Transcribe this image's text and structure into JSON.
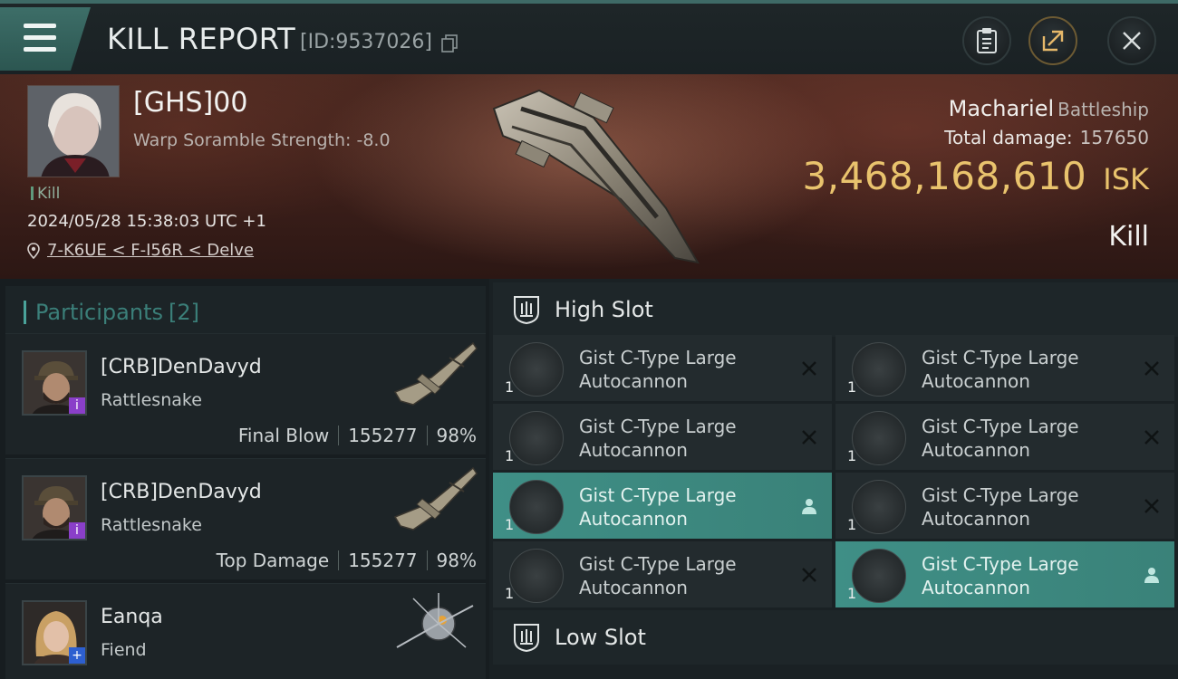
{
  "header": {
    "title": "KILL REPORT",
    "report_id": "[ID:9537026]"
  },
  "victim": {
    "name": "[GHS]00",
    "scramble": "Warp Soramble Strength: -8.0",
    "tag": "Kill",
    "datetime": "2024/05/28 15:38:03 UTC +1",
    "location": "7-K6UE < F-I56R < Delve",
    "ship_name": "Machariel",
    "ship_class": "Battleship",
    "total_damage_label": "Total damage:",
    "total_damage": "157650",
    "isk_value": "3,468,168,610",
    "isk_unit": "ISK",
    "outcome": "Kill"
  },
  "participants": {
    "label": "Participants",
    "count": "[2]",
    "items": [
      {
        "name": "[CRB]DenDavyd",
        "ship": "Rattlesnake",
        "role": "Final Blow",
        "damage": "155277",
        "percent": "98%",
        "badge": "i"
      },
      {
        "name": "[CRB]DenDavyd",
        "ship": "Rattlesnake",
        "role": "Top Damage",
        "damage": "155277",
        "percent": "98%",
        "badge": "i"
      },
      {
        "name": "Eanqa",
        "ship": "Fiend",
        "badge": "+"
      }
    ]
  },
  "fittings": {
    "high_slot_label": "High Slot",
    "low_slot_label": "Low Slot",
    "high_modules": [
      {
        "name": "Gist C-Type Large Autocannon",
        "qty": "1",
        "status": "destroyed"
      },
      {
        "name": "Gist C-Type Large Autocannon",
        "qty": "1",
        "status": "destroyed"
      },
      {
        "name": "Gist C-Type Large Autocannon",
        "qty": "1",
        "status": "destroyed"
      },
      {
        "name": "Gist C-Type Large Autocannon",
        "qty": "1",
        "status": "destroyed"
      },
      {
        "name": "Gist C-Type Large Autocannon",
        "qty": "1",
        "status": "dropped"
      },
      {
        "name": "Gist C-Type Large Autocannon",
        "qty": "1",
        "status": "destroyed"
      },
      {
        "name": "Gist C-Type Large Autocannon",
        "qty": "1",
        "status": "destroyed"
      },
      {
        "name": "Gist C-Type Large Autocannon",
        "qty": "1",
        "status": "dropped"
      }
    ]
  },
  "colors": {
    "accent_teal": "#3f8f86",
    "isk_gold": "#e9c36d",
    "badge_purple": "#8a3fc9",
    "badge_blue": "#2d5fd0"
  }
}
